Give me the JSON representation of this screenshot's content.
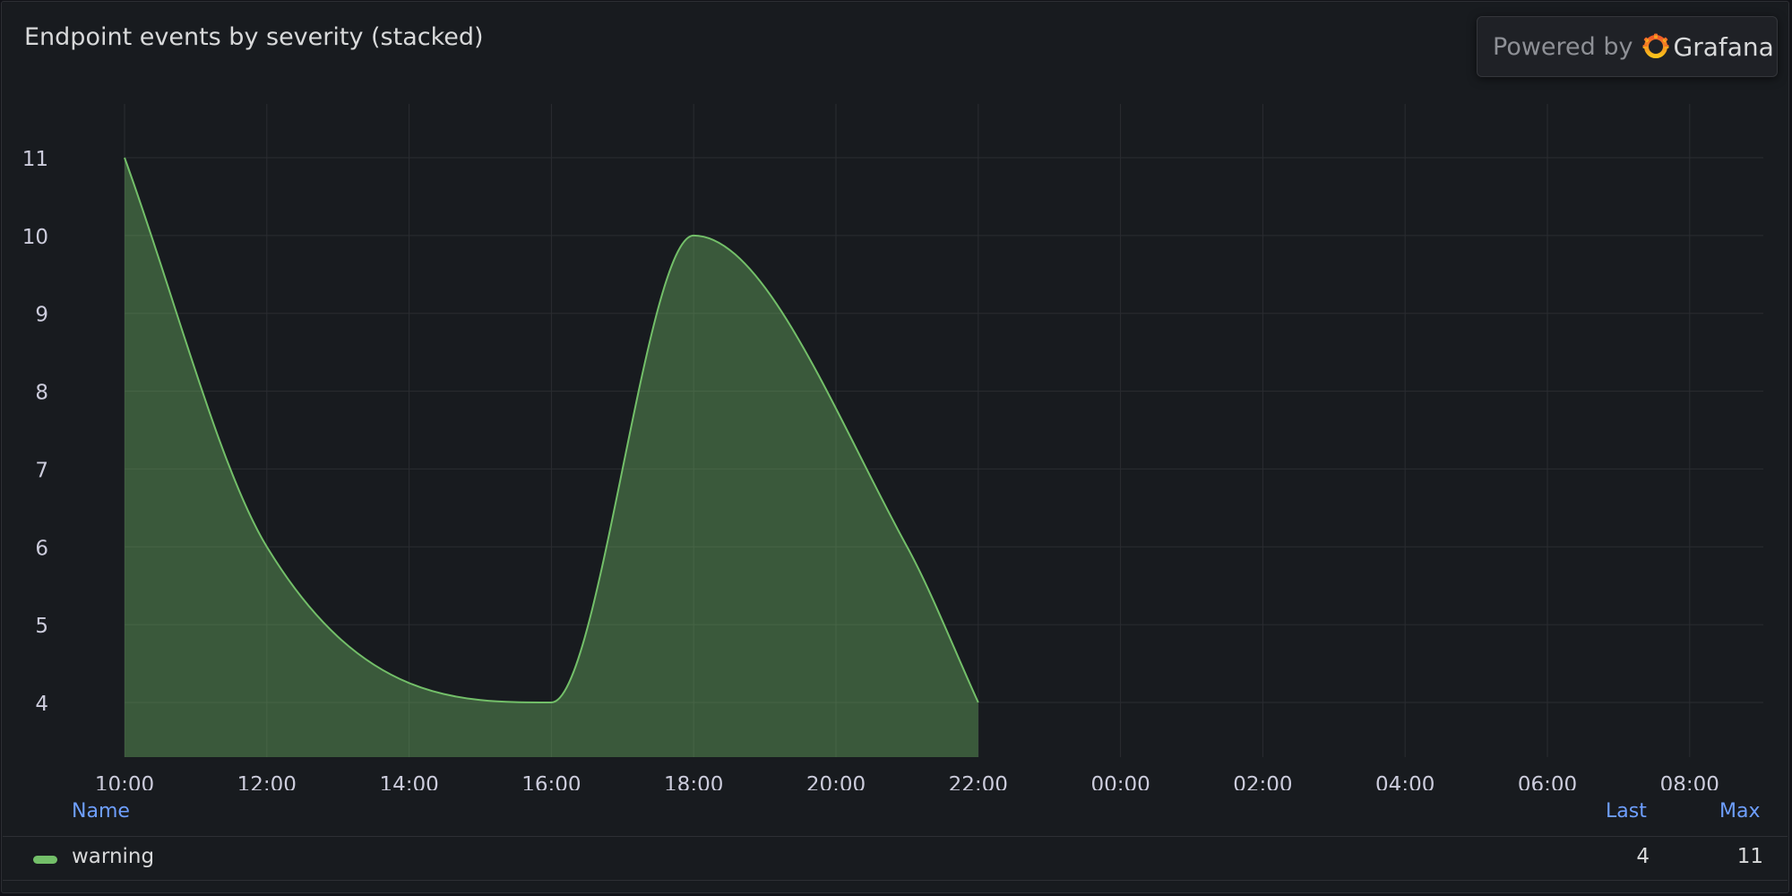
{
  "panel": {
    "title": "Endpoint events by severity (stacked)"
  },
  "powered_by": {
    "label": "Powered by",
    "brand": "Grafana",
    "icon": "grafana-logo-icon"
  },
  "legend": {
    "headers": {
      "name": "Name",
      "last": "Last",
      "max": "Max"
    },
    "rows": [
      {
        "name": "warning",
        "last": "4",
        "max": "11",
        "color": "#73bf69"
      }
    ]
  },
  "chart_data": {
    "type": "area",
    "title": "Endpoint events by severity (stacked)",
    "xlabel": "",
    "ylabel": "",
    "x_ticks": [
      "10:00",
      "12:00",
      "14:00",
      "16:00",
      "18:00",
      "20:00",
      "22:00",
      "00:00",
      "02:00",
      "04:00",
      "06:00",
      "08:00"
    ],
    "y_ticks": [
      4,
      5,
      6,
      7,
      8,
      9,
      10,
      11
    ],
    "x_range_hours": [
      10,
      33.5
    ],
    "ylim": [
      3.3,
      11.8
    ],
    "grid": true,
    "legend_position": "bottom",
    "series": [
      {
        "name": "warning",
        "color": "#73bf69",
        "fill_color": "#73bf69",
        "stacked": true,
        "x": [
          "10:00",
          "12:00",
          "16:00",
          "18:00",
          "21:00",
          "22:00"
        ],
        "values": [
          11,
          6,
          4,
          10,
          6,
          4
        ]
      }
    ]
  }
}
